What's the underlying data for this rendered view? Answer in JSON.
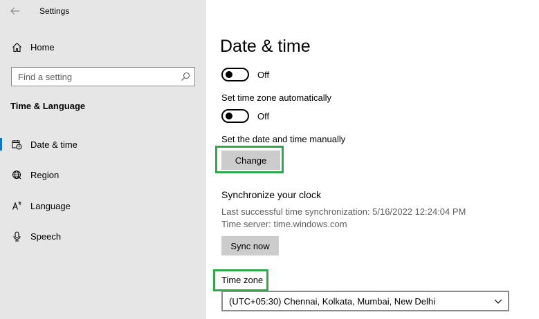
{
  "app": {
    "title": "Settings"
  },
  "sidebar": {
    "home_label": "Home",
    "search_placeholder": "Find a setting",
    "section_heading": "Time & Language",
    "items": [
      {
        "label": "Date & time",
        "icon": "calendar-clock-icon",
        "selected": true
      },
      {
        "label": "Region",
        "icon": "globe-icon",
        "selected": false
      },
      {
        "label": "Language",
        "icon": "language-icon",
        "selected": false
      },
      {
        "label": "Speech",
        "icon": "microphone-icon",
        "selected": false
      }
    ]
  },
  "main": {
    "title": "Date & time",
    "set_time_auto": {
      "state": "Off"
    },
    "set_timezone_auto": {
      "label": "Set time zone automatically",
      "state": "Off"
    },
    "manual": {
      "label": "Set the date and time manually",
      "button": "Change"
    },
    "sync": {
      "heading": "Synchronize your clock",
      "last_sync": "Last successful time synchronization: 5/16/2022 12:24:04 PM",
      "server": "Time server: time.windows.com",
      "button": "Sync now"
    },
    "timezone": {
      "label": "Time zone",
      "selected": "(UTC+05:30) Chennai, Kolkata, Mumbai, New Delhi"
    }
  },
  "colors": {
    "sidebar_bg": "#e6e6e6",
    "accent": "#0078d7",
    "highlight": "#2eaa4a",
    "button_bg": "#cccccc"
  }
}
